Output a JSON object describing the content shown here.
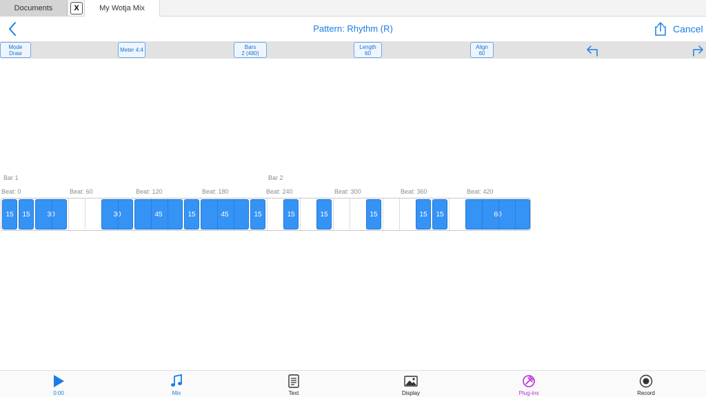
{
  "tabs": {
    "documents_label": "Documents",
    "close_label": "X",
    "active_label": "My Wotja Mix"
  },
  "nav": {
    "title": "Pattern: Rhythm (R)",
    "cancel_label": "Cancel"
  },
  "toolbar": {
    "mode": {
      "line1": "Mode",
      "line2": "Draw"
    },
    "meter": {
      "label": "Meter 4:4"
    },
    "bars": {
      "line1": "Bars",
      "line2": "2 (480)"
    },
    "length": {
      "line1": "Length",
      "line2": "60"
    },
    "align": {
      "line1": "Align",
      "line2": "60"
    }
  },
  "pattern": {
    "bar_labels": [
      "Bar 1",
      "Bar 2"
    ],
    "beat_labels": [
      "Beat: 0",
      "Beat: 60",
      "Beat: 120",
      "Beat: 180",
      "Beat: 240",
      "Beat: 300",
      "Beat: 360",
      "Beat: 420"
    ],
    "notes": [
      {
        "start": 0,
        "length": 15,
        "label": "15"
      },
      {
        "start": 15,
        "length": 15,
        "label": "15"
      },
      {
        "start": 30,
        "length": 30,
        "label": "30"
      },
      {
        "start": 90,
        "length": 30,
        "label": "30"
      },
      {
        "start": 120,
        "length": 45,
        "label": "45"
      },
      {
        "start": 165,
        "length": 15,
        "label": "15"
      },
      {
        "start": 180,
        "length": 45,
        "label": "45"
      },
      {
        "start": 225,
        "length": 15,
        "label": "15"
      },
      {
        "start": 255,
        "length": 15,
        "label": "15"
      },
      {
        "start": 285,
        "length": 15,
        "label": "15"
      },
      {
        "start": 330,
        "length": 15,
        "label": "15"
      },
      {
        "start": 375,
        "length": 15,
        "label": "15"
      },
      {
        "start": 390,
        "length": 15,
        "label": "15"
      },
      {
        "start": 420,
        "length": 60,
        "label": "60"
      }
    ],
    "total_ticks": 480
  },
  "bottom": {
    "items": [
      {
        "label": "0:00",
        "icon": "play-icon",
        "color": "#1a7de4"
      },
      {
        "label": "Mix",
        "icon": "music-note-icon",
        "color": "#1a7de4"
      },
      {
        "label": "Text",
        "icon": "document-icon",
        "color": "#222222"
      },
      {
        "label": "Display",
        "icon": "image-icon",
        "color": "#222222"
      },
      {
        "label": "Plug-ins",
        "icon": "plugin-icon",
        "color": "#b62fd6"
      },
      {
        "label": "Record",
        "icon": "record-icon",
        "color": "#222222"
      }
    ]
  },
  "colors": {
    "accent": "#1a7de4",
    "note_fill": "#3593f5",
    "plugin": "#b62fd6"
  }
}
